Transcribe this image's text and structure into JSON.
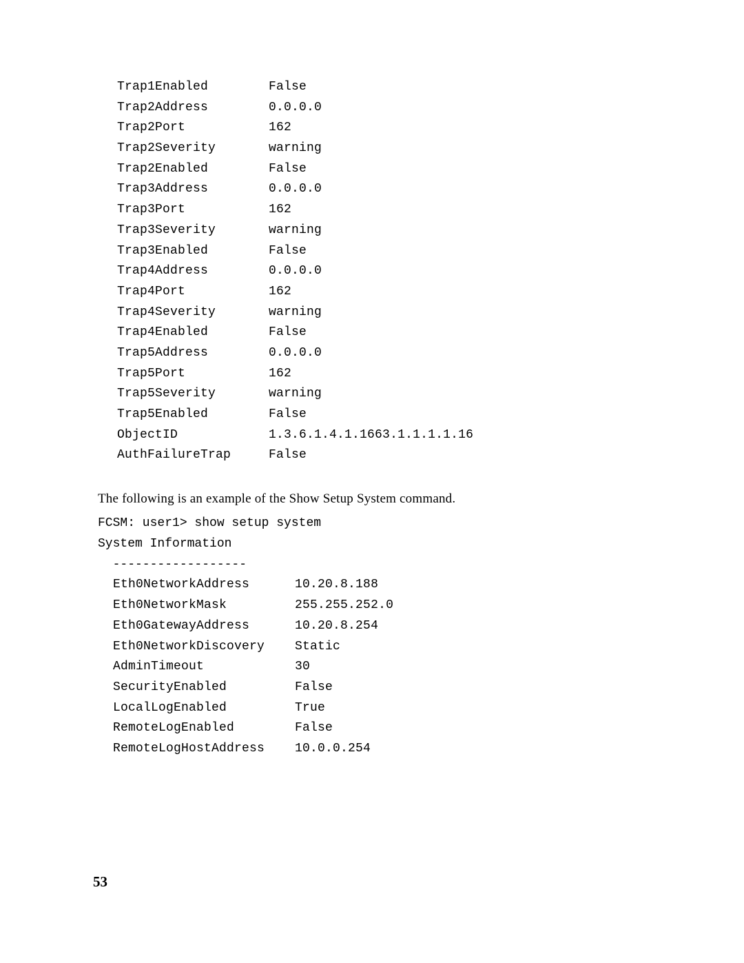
{
  "trap_params": [
    {
      "name": "Trap1Enabled",
      "value": "False"
    },
    {
      "name": "Trap2Address",
      "value": "0.0.0.0"
    },
    {
      "name": "Trap2Port",
      "value": "162"
    },
    {
      "name": "Trap2Severity",
      "value": "warning"
    },
    {
      "name": "Trap2Enabled",
      "value": "False"
    },
    {
      "name": "Trap3Address",
      "value": "0.0.0.0"
    },
    {
      "name": "Trap3Port",
      "value": "162"
    },
    {
      "name": "Trap3Severity",
      "value": "warning"
    },
    {
      "name": "Trap3Enabled",
      "value": "False"
    },
    {
      "name": "Trap4Address",
      "value": "0.0.0.0"
    },
    {
      "name": "Trap4Port",
      "value": "162"
    },
    {
      "name": "Trap4Severity",
      "value": "warning"
    },
    {
      "name": "Trap4Enabled",
      "value": "False"
    },
    {
      "name": "Trap5Address",
      "value": "0.0.0.0"
    },
    {
      "name": "Trap5Port",
      "value": "162"
    },
    {
      "name": "Trap5Severity",
      "value": "warning"
    },
    {
      "name": "Trap5Enabled",
      "value": "False"
    },
    {
      "name": "ObjectID",
      "value": "1.3.6.1.4.1.1663.1.1.1.1.16"
    },
    {
      "name": "AuthFailureTrap",
      "value": "False"
    }
  ],
  "intro_text": "The following is an example of the Show Setup System command.",
  "command_line": "FCSM: user1> show setup system",
  "sys_heading": "System Information",
  "divider": "  ------------------",
  "sys_params": [
    {
      "name": "Eth0NetworkAddress",
      "value": "10.20.8.188"
    },
    {
      "name": "Eth0NetworkMask",
      "value": "255.255.252.0"
    },
    {
      "name": "Eth0GatewayAddress",
      "value": "10.20.8.254"
    },
    {
      "name": "Eth0NetworkDiscovery",
      "value": "Static"
    },
    {
      "name": "AdminTimeout",
      "value": "30"
    },
    {
      "name": "SecurityEnabled",
      "value": "False"
    },
    {
      "name": "LocalLogEnabled",
      "value": "True"
    },
    {
      "name": "RemoteLogEnabled",
      "value": "False"
    },
    {
      "name": "RemoteLogHostAddress",
      "value": "10.0.0.254"
    }
  ],
  "page_number": "53"
}
